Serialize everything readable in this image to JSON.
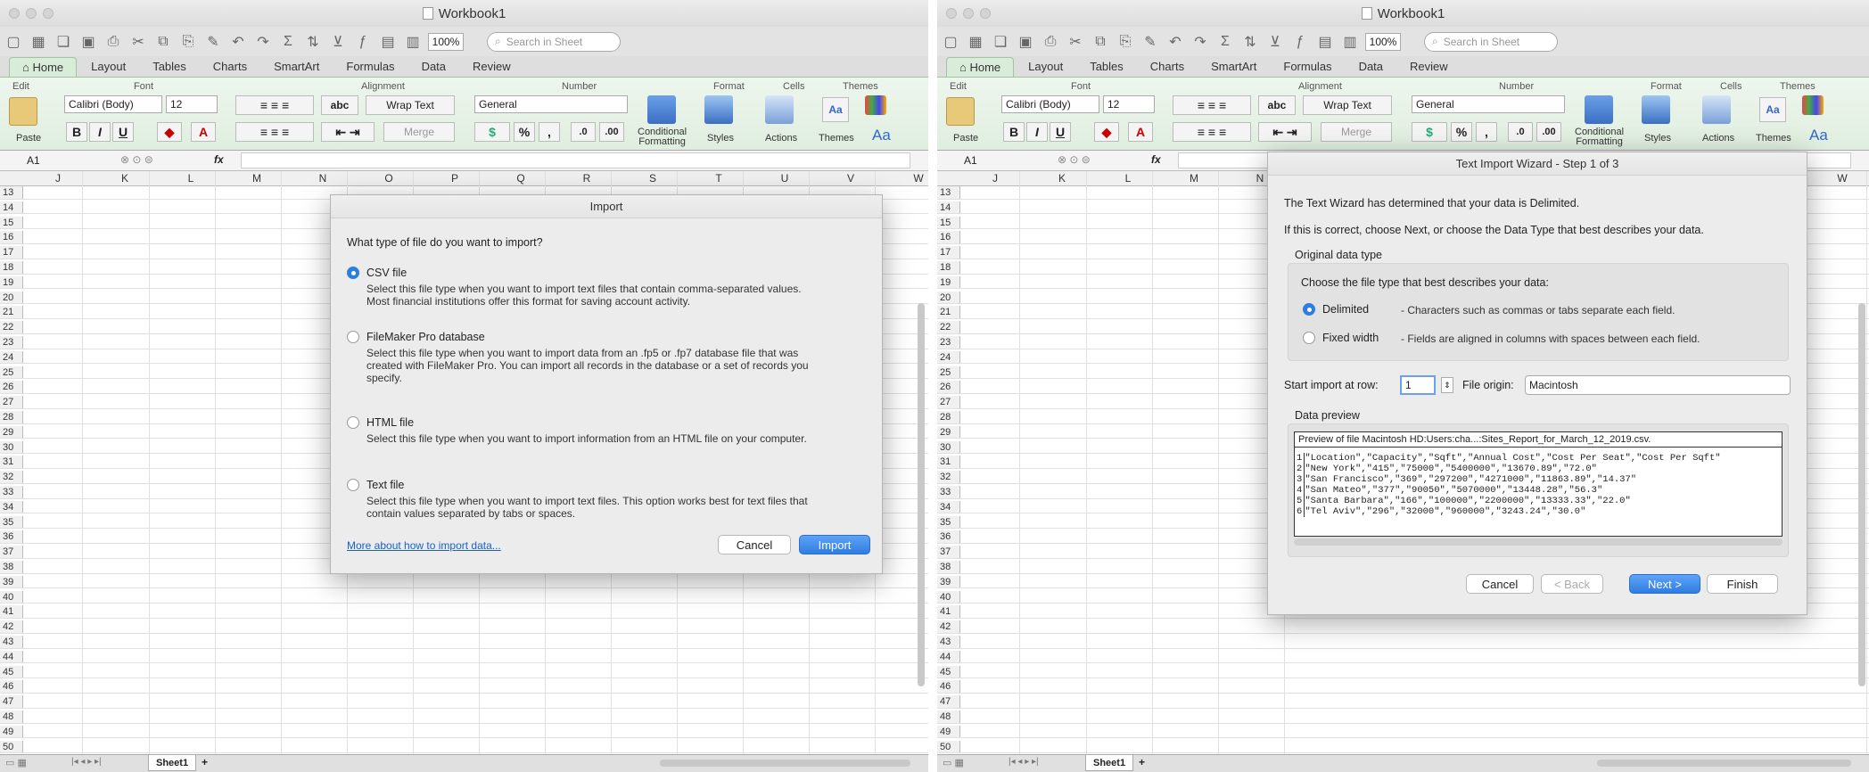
{
  "window": {
    "title": "Workbook1"
  },
  "toolbar": {
    "zoom": "100%",
    "search_placeholder": "Search in Sheet"
  },
  "tabs": [
    "Home",
    "Layout",
    "Tables",
    "Charts",
    "SmartArt",
    "Formulas",
    "Data",
    "Review"
  ],
  "ribbon": {
    "groups": [
      "Edit",
      "Font",
      "Alignment",
      "Number",
      "Format",
      "Cells",
      "Themes"
    ],
    "paste": "Paste",
    "font_name": "Calibri (Body)",
    "font_size": "12",
    "wrap_text": "Wrap Text",
    "merge": "Merge",
    "number_format": "General",
    "conditional": "Conditional",
    "formatting": "Formatting",
    "styles": "Styles",
    "actions": "Actions",
    "themes": "Themes",
    "bold": "B",
    "italic": "I",
    "underline": "U",
    "percent": "%",
    "comma": ",",
    "abc": "abc",
    "aa": "Aa"
  },
  "formula_bar": {
    "cell_ref": "A1",
    "fx": "fx"
  },
  "left": {
    "columns": [
      "J",
      "K",
      "L",
      "M",
      "N",
      "O",
      "P",
      "Q",
      "R",
      "S",
      "T",
      "U",
      "V",
      "W"
    ]
  },
  "right": {
    "columns": [
      "J",
      "K",
      "L",
      "M",
      "N",
      "W"
    ]
  },
  "rows": [
    "13",
    "14",
    "15",
    "16",
    "17",
    "18",
    "19",
    "20",
    "21",
    "22",
    "23",
    "24",
    "25",
    "26",
    "27",
    "28",
    "29",
    "30",
    "31",
    "32",
    "33",
    "34",
    "35",
    "36",
    "37",
    "38",
    "39",
    "40",
    "41",
    "42",
    "43",
    "44",
    "45",
    "46",
    "47",
    "48",
    "49",
    "50"
  ],
  "sheet": {
    "tab": "Sheet1",
    "add": "+"
  },
  "import_dialog": {
    "title": "Import",
    "question": "What type of file do you want to import?",
    "options": [
      {
        "label": "CSV file",
        "selected": true,
        "desc": [
          "Select this file type when you want to import text files that contain comma-separated values.",
          "Most financial institutions offer this format for saving account activity."
        ]
      },
      {
        "label": "FileMaker Pro database",
        "selected": false,
        "desc": [
          "Select this file type when you want to import data from an .fp5 or .fp7 database file that was",
          "created with FileMaker Pro.  You can import all records in the database or a set of records you",
          "specify."
        ]
      },
      {
        "label": "HTML file",
        "selected": false,
        "desc": [
          "Select this file type when you want to import information from an HTML file on your computer."
        ]
      },
      {
        "label": "Text file",
        "selected": false,
        "desc": [
          "Select this file type when you want to import text files.  This option works best for text files that",
          "contain values separated by tabs or spaces."
        ]
      }
    ],
    "help_link": "More about how to import data...",
    "cancel": "Cancel",
    "import": "Import"
  },
  "wizard": {
    "title": "Text Import Wizard - Step 1 of 3",
    "line1": "The Text Wizard has determined that your data is Delimited.",
    "line2": "If this is correct, choose Next, or choose the Data Type that best describes your data.",
    "original_type": "Original data type",
    "choose": "Choose the file type that best describes your data:",
    "delimited": "Delimited",
    "delimited_desc": "- Characters such as commas or tabs separate each field.",
    "fixed": "Fixed width",
    "fixed_desc": "- Fields are aligned in columns with spaces between each field.",
    "start_row_label": "Start import at row:",
    "start_row": "1",
    "origin_label": "File origin:",
    "origin": "Macintosh",
    "preview_label": "Data preview",
    "preview_file": "Preview of file Macintosh HD:Users:cha...:Sites_Report_for_March_12_2019.csv.",
    "preview_lines": [
      "\"Location\",\"Capacity\",\"Sqft\",\"Annual Cost\",\"Cost Per Seat\",\"Cost Per Sqft\"",
      "\"New York\",\"415\",\"75000\",\"5400000\",\"13670.89\",\"72.0\"",
      "\"San Francisco\",\"369\",\"297200\",\"4271000\",\"11863.89\",\"14.37\"",
      "\"San Mateo\",\"377\",\"90050\",\"5070000\",\"13448.28\",\"56.3\"",
      "\"Santa Barbara\",\"166\",\"100000\",\"2200000\",\"13333.33\",\"22.0\"",
      "\"Tel Aviv\",\"296\",\"32000\",\"960000\",\"3243.24\",\"30.0\""
    ],
    "preview_nums": [
      "1",
      "2",
      "3",
      "4",
      "5",
      "6"
    ],
    "cancel": "Cancel",
    "back": "< Back",
    "next": "Next >",
    "finish": "Finish"
  }
}
